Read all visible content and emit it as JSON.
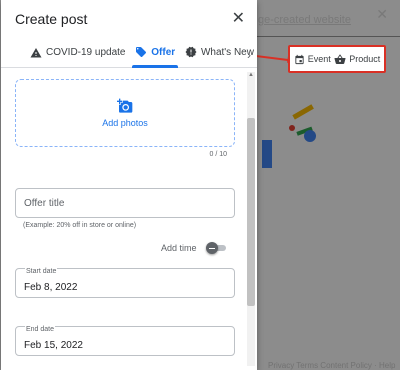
{
  "background": {
    "header_text": "ge-created website",
    "footer_text": "Privacy Terms Content Policy · Help"
  },
  "dialog": {
    "title": "Create post",
    "tabs": [
      {
        "label": "COVID-19 update",
        "icon": "warning-icon",
        "active": false
      },
      {
        "label": "Offer",
        "icon": "tag-icon",
        "active": true
      },
      {
        "label": "What's New",
        "icon": "news-icon",
        "active": false
      }
    ],
    "more_tabs_icon": "chevron-right-icon",
    "photos": {
      "label": "Add photos",
      "counter": "0 / 10"
    },
    "offer_title": {
      "placeholder": "Offer title",
      "helper": "(Example: 20% off in store or online)"
    },
    "add_time": {
      "label": "Add time",
      "enabled": false
    },
    "start_date": {
      "label": "Start date",
      "value": "Feb 8, 2022"
    },
    "end_date": {
      "label": "End date",
      "value": "Feb 15, 2022"
    }
  },
  "callout": {
    "items": [
      {
        "label": "Event",
        "icon": "calendar-event-icon"
      },
      {
        "label": "Product",
        "icon": "shopping-basket-icon"
      }
    ],
    "color": "#d93025"
  },
  "colors": {
    "accent": "#1a73e8",
    "annotation": "#d93025"
  }
}
